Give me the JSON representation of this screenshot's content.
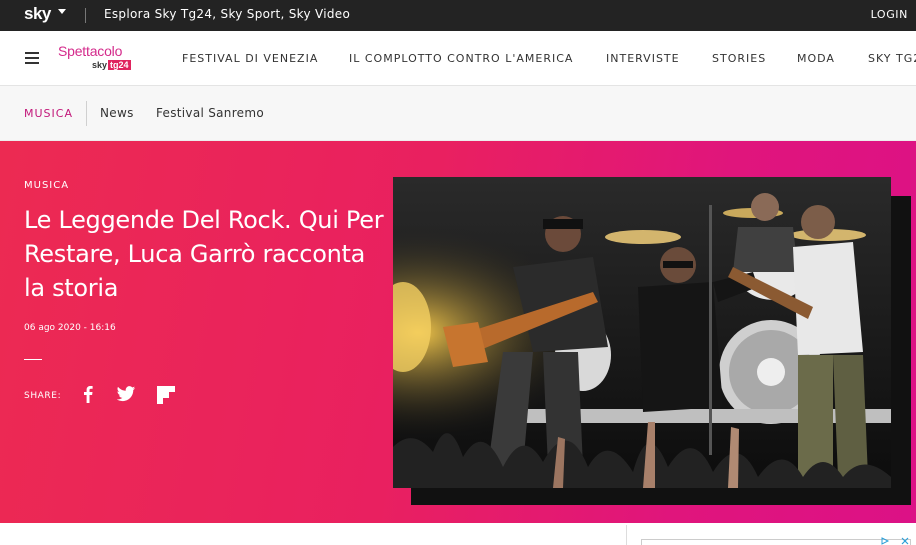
{
  "topbar": {
    "logo": "sky",
    "explore": "Esplora Sky Tg24, Sky Sport, Sky Video",
    "login": "LOGIN"
  },
  "brand": {
    "title": "Spettacolo",
    "sub_sky": "sky",
    "sub_tg": "tg24"
  },
  "nav": {
    "items": [
      "FESTIVAL DI VENEZIA",
      "IL COMPLOTTO CONTRO L'AMERICA",
      "INTERVISTE",
      "STORIES",
      "MODA",
      "SKY TG2"
    ]
  },
  "subnav": {
    "active": "MUSICA",
    "items": [
      "News",
      "Festival Sanremo"
    ]
  },
  "article": {
    "category": "MUSICA",
    "title": "Le Leggende Del Rock. Qui Per Restare, Luca Garrò racconta la storia",
    "date": "06 ago 2020 - 16:16",
    "share_label": "SHARE:"
  },
  "colors": {
    "topbar": "#232323",
    "accent": "#d42a8b",
    "hero_start": "#ec2a52",
    "hero_end": "#dc1186"
  },
  "icons": [
    "hamburger-icon",
    "facebook-icon",
    "twitter-icon",
    "flipboard-icon",
    "chevron-down-icon"
  ]
}
